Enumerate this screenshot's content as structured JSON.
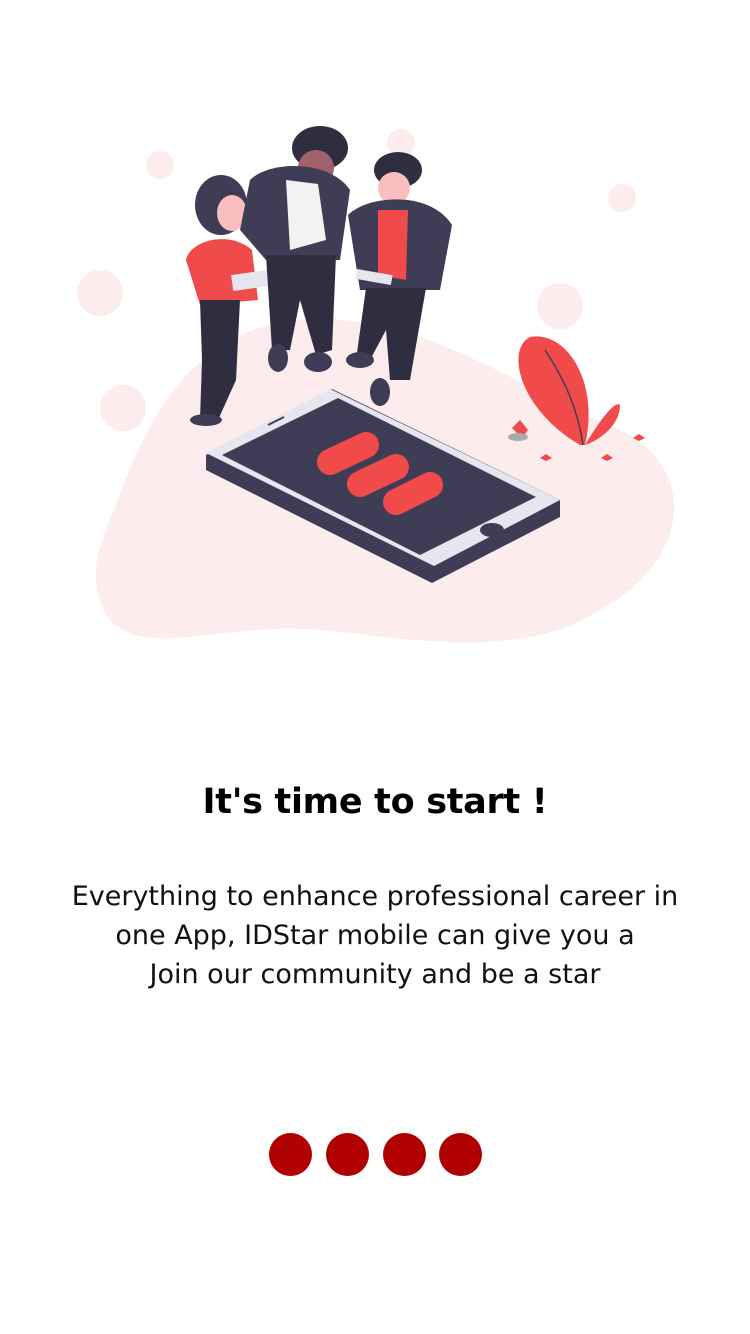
{
  "onboarding": {
    "title": "It's time to start !",
    "description_lines": [
      "Everything to enhance professional career in",
      "one App, IDStar mobile can give you a",
      "Join our community and be a star"
    ],
    "pagination": {
      "count": 4,
      "color": "#b00000"
    }
  },
  "colors": {
    "accent": "#f04a4a",
    "blob": "#fdeced",
    "dark": "#3f3d56"
  }
}
